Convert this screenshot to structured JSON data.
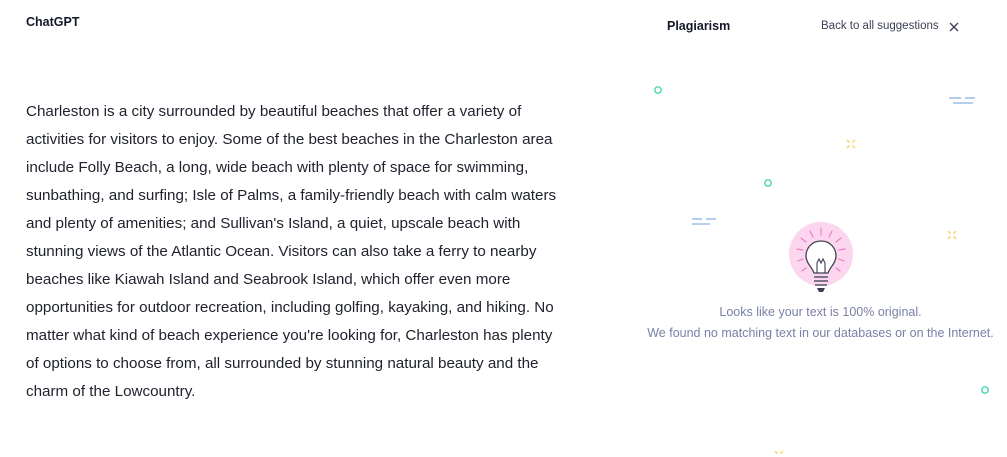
{
  "document": {
    "title": "ChatGPT",
    "body": "Charleston is a city surrounded by beautiful beaches that offer a variety of activities for visitors to enjoy. Some of the best beaches in the Charleston area include Folly Beach, a long, wide beach with plenty of space for swimming, sunbathing, and surfing; Isle of Palms, a family-friendly beach with calm waters and plenty of amenities; and Sullivan's Island, a quiet, upscale beach with stunning views of the Atlantic Ocean. Visitors can also take a ferry to nearby beaches like Kiawah Island and Seabrook Island, which offer even more opportunities for outdoor recreation, including golfing, kayaking, and hiking. No matter what kind of beach experience you're looking for, Charleston has plenty of options to choose from, all surrounded by stunning natural beauty and the charm of the Lowcountry."
  },
  "panel": {
    "title": "Plagiarism",
    "back_label": "Back to all suggestions",
    "close_icon": "close-icon",
    "illustration_icon": "lightbulb-icon",
    "result_line1": "Looks like your text is 100% original.",
    "result_line2": "We found no matching text in our databases or on the Internet."
  },
  "colors": {
    "accent_teal": "#48d6b4",
    "accent_blue": "#8ab0e8",
    "accent_yellow": "#f2d65a",
    "bulb_glow": "#fbd6ee",
    "bulb_rays": "#ec7fc4",
    "muted_text": "#7a80a6"
  }
}
